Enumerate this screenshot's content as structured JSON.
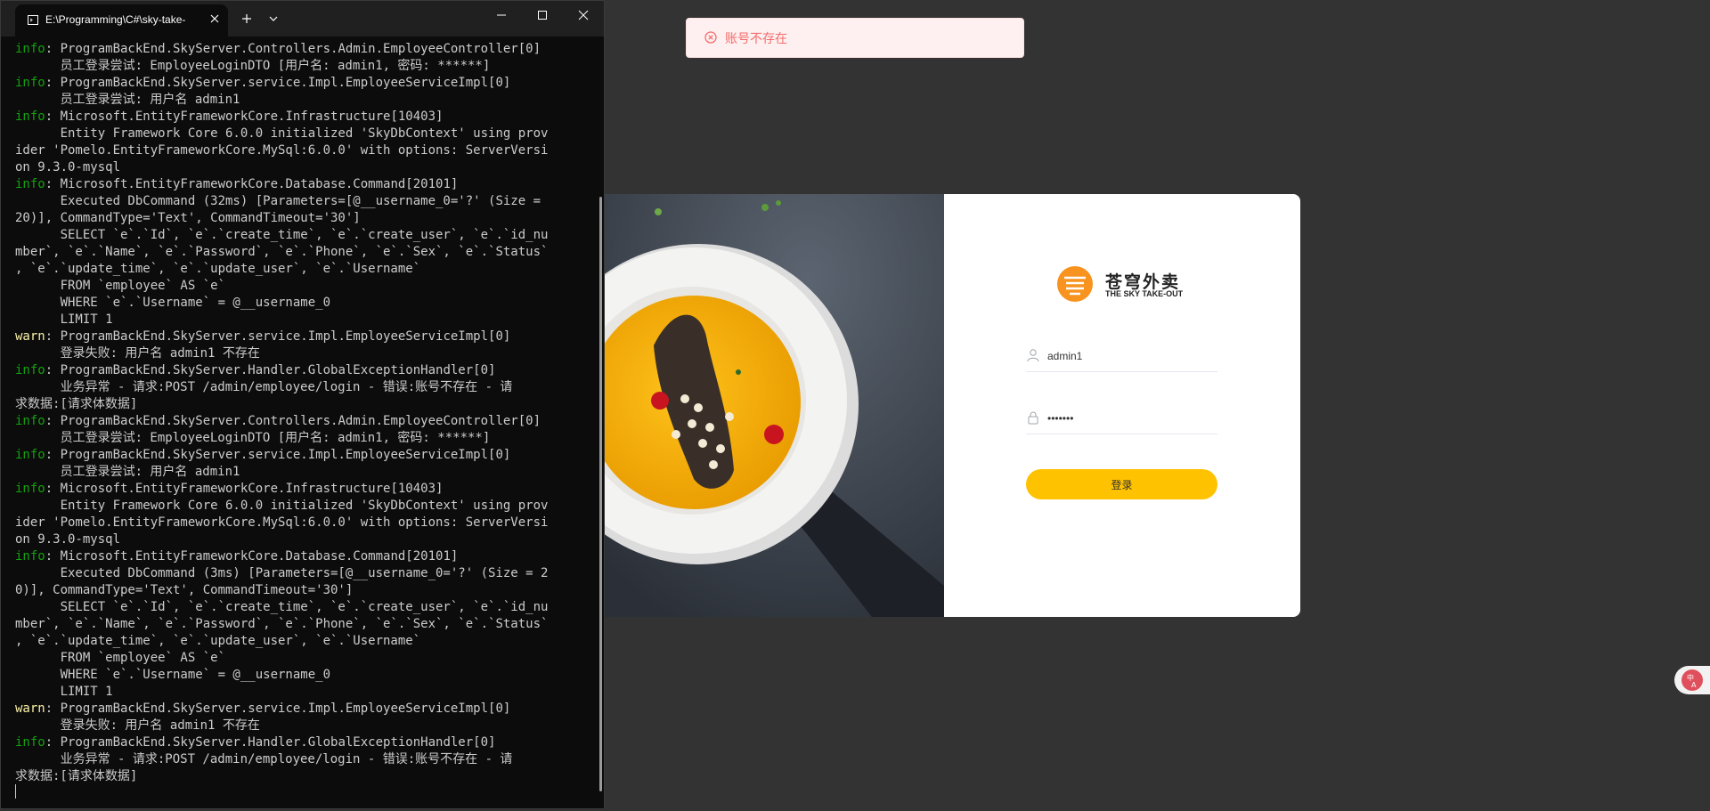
{
  "terminal": {
    "tab_title": "E:\\Programming\\C#\\sky-take-",
    "lines": [
      {
        "level": "info",
        "text": ": ProgramBackEnd.SkyServer.Controllers.Admin.EmployeeController[0]"
      },
      {
        "level": "",
        "text": "      员工登录尝试: EmployeeLoginDTO [用户名: admin1, 密码: ******]"
      },
      {
        "level": "info",
        "text": ": ProgramBackEnd.SkyServer.service.Impl.EmployeeServiceImpl[0]"
      },
      {
        "level": "",
        "text": "      员工登录尝试: 用户名 admin1"
      },
      {
        "level": "info",
        "text": ": Microsoft.EntityFrameworkCore.Infrastructure[10403]"
      },
      {
        "level": "",
        "text": "      Entity Framework Core 6.0.0 initialized 'SkyDbContext' using prov"
      },
      {
        "level": "",
        "text": "ider 'Pomelo.EntityFrameworkCore.MySql:6.0.0' with options: ServerVersi"
      },
      {
        "level": "",
        "text": "on 9.3.0-mysql"
      },
      {
        "level": "info",
        "text": ": Microsoft.EntityFrameworkCore.Database.Command[20101]"
      },
      {
        "level": "",
        "text": "      Executed DbCommand (32ms) [Parameters=[@__username_0='?' (Size ="
      },
      {
        "level": "",
        "text": "20)], CommandType='Text', CommandTimeout='30']"
      },
      {
        "level": "",
        "text": "      SELECT `e`.`Id`, `e`.`create_time`, `e`.`create_user`, `e`.`id_nu"
      },
      {
        "level": "",
        "text": "mber`, `e`.`Name`, `e`.`Password`, `e`.`Phone`, `e`.`Sex`, `e`.`Status`"
      },
      {
        "level": "",
        "text": ", `e`.`update_time`, `e`.`update_user`, `e`.`Username`"
      },
      {
        "level": "",
        "text": "      FROM `employee` AS `e`"
      },
      {
        "level": "",
        "text": "      WHERE `e`.`Username` = @__username_0"
      },
      {
        "level": "",
        "text": "      LIMIT 1"
      },
      {
        "level": "warn",
        "text": ": ProgramBackEnd.SkyServer.service.Impl.EmployeeServiceImpl[0]"
      },
      {
        "level": "",
        "text": "      登录失败: 用户名 admin1 不存在"
      },
      {
        "level": "info",
        "text": ": ProgramBackEnd.SkyServer.Handler.GlobalExceptionHandler[0]"
      },
      {
        "level": "",
        "text": "      业务异常 - 请求:POST /admin/employee/login - 错误:账号不存在 - 请"
      },
      {
        "level": "",
        "text": "求数据:[请求体数据]"
      },
      {
        "level": "info",
        "text": ": ProgramBackEnd.SkyServer.Controllers.Admin.EmployeeController[0]"
      },
      {
        "level": "",
        "text": "      员工登录尝试: EmployeeLoginDTO [用户名: admin1, 密码: ******]"
      },
      {
        "level": "info",
        "text": ": ProgramBackEnd.SkyServer.service.Impl.EmployeeServiceImpl[0]"
      },
      {
        "level": "",
        "text": "      员工登录尝试: 用户名 admin1"
      },
      {
        "level": "info",
        "text": ": Microsoft.EntityFrameworkCore.Infrastructure[10403]"
      },
      {
        "level": "",
        "text": "      Entity Framework Core 6.0.0 initialized 'SkyDbContext' using prov"
      },
      {
        "level": "",
        "text": "ider 'Pomelo.EntityFrameworkCore.MySql:6.0.0' with options: ServerVersi"
      },
      {
        "level": "",
        "text": "on 9.3.0-mysql"
      },
      {
        "level": "info",
        "text": ": Microsoft.EntityFrameworkCore.Database.Command[20101]"
      },
      {
        "level": "",
        "text": "      Executed DbCommand (3ms) [Parameters=[@__username_0='?' (Size = 2"
      },
      {
        "level": "",
        "text": "0)], CommandType='Text', CommandTimeout='30']"
      },
      {
        "level": "",
        "text": "      SELECT `e`.`Id`, `e`.`create_time`, `e`.`create_user`, `e`.`id_nu"
      },
      {
        "level": "",
        "text": "mber`, `e`.`Name`, `e`.`Password`, `e`.`Phone`, `e`.`Sex`, `e`.`Status`"
      },
      {
        "level": "",
        "text": ", `e`.`update_time`, `e`.`update_user`, `e`.`Username`"
      },
      {
        "level": "",
        "text": "      FROM `employee` AS `e`"
      },
      {
        "level": "",
        "text": "      WHERE `e`.`Username` = @__username_0"
      },
      {
        "level": "",
        "text": "      LIMIT 1"
      },
      {
        "level": "warn",
        "text": ": ProgramBackEnd.SkyServer.service.Impl.EmployeeServiceImpl[0]"
      },
      {
        "level": "",
        "text": "      登录失败: 用户名 admin1 不存在"
      },
      {
        "level": "info",
        "text": ": ProgramBackEnd.SkyServer.Handler.GlobalExceptionHandler[0]"
      },
      {
        "level": "",
        "text": "      业务异常 - 请求:POST /admin/employee/login - 错误:账号不存在 - 请"
      },
      {
        "level": "",
        "text": "求数据:[请求体数据]"
      }
    ]
  },
  "toast": {
    "message": "账号不存在",
    "color": "#f56c6c"
  },
  "login": {
    "logo_cn": "苍穹外卖",
    "logo_en": "THE SKY TAKE-OUT",
    "username_value": "admin1",
    "password_value": "•••••••",
    "login_button": "登录",
    "accent_color": "#ffc200"
  },
  "icons": [
    "terminal-icon",
    "close-icon",
    "plus-icon",
    "chevron-down-icon",
    "minimize-icon",
    "maximize-icon",
    "error-icon",
    "user-icon",
    "lock-icon",
    "translate-icon"
  ]
}
